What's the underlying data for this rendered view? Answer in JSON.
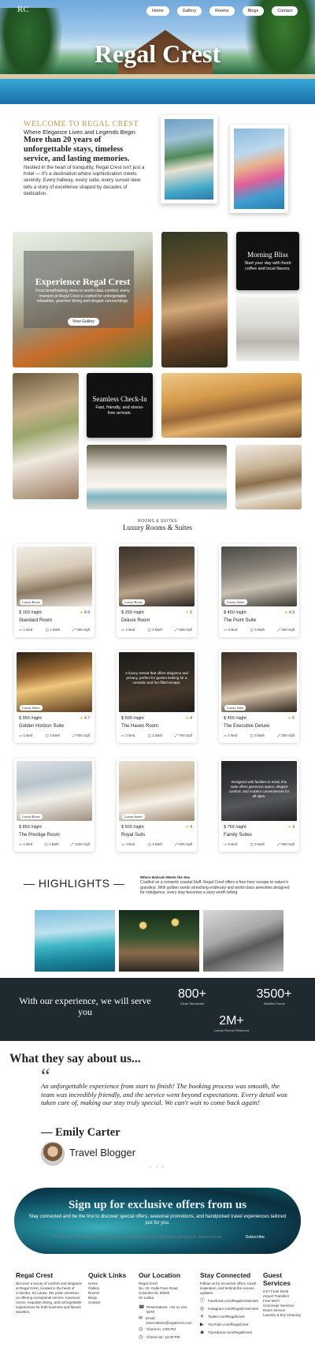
{
  "header": {
    "logo_mark": "RC",
    "title": "Regal Crest",
    "nav": [
      "Home",
      "Gallery",
      "Rooms",
      "Blogs",
      "Contact"
    ]
  },
  "welcome": {
    "kicker": "WELCOME TO REGAL CREST",
    "subtitle": "Where Elegance Lives and Legends Begin",
    "headline": "More than 20 years of unforgettable stays, timeless service, and lasting memories.",
    "body": "Nestled in the heart of tranquility, Regal Crest isn't just a hotel — it's a destination where sophistication meets serenity. Every hallway, every suite, every sunset view tells a story of excellence shaped by decades of dedication."
  },
  "gallery": {
    "experience": {
      "title": "Experience Regal Crest",
      "desc": "From breathtaking views to world-class comfort, every moment at Regal Crest is crafted for unforgettable relaxation, gourmet dining and elegant surroundings.",
      "button": "View Gallery"
    },
    "morning_bliss": {
      "title": "Morning Bliss",
      "desc": "Start your day with fresh coffee and local flavors."
    },
    "checkin": {
      "title": "Seamless Check-In",
      "desc": "Fast, friendly, and stress-free arrivals."
    }
  },
  "rooms": {
    "kicker": "ROOMS & SUITES",
    "title": "Luxury Rooms & Suites",
    "items": [
      {
        "tag": "Luxury Room",
        "price": "$ 150 /night",
        "rating": "4.9",
        "name": "Standard Room",
        "beds": "1 Bed",
        "baths": "1 Bath",
        "size": "300 Sqft",
        "overlay": ""
      },
      {
        "tag": "Luxury Room",
        "price": "$ 250 /night",
        "rating": "5",
        "name": "Deluxe Room",
        "beds": "2 Bed",
        "baths": "2 Bath",
        "size": "500 Sqft",
        "overlay": ""
      },
      {
        "tag": "Luxury Suites",
        "price": "$ 450 /night",
        "rating": "4.9",
        "name": "The Point Suite",
        "beds": "3 Bed",
        "baths": "3 Bath",
        "size": "250 Sqft",
        "overlay": ""
      },
      {
        "tag": "Luxury Suites",
        "price": "$ 950 /night",
        "rating": "4.7",
        "name": "Golden Horizon Suite",
        "beds": "1 Bed",
        "baths": "3 Bath",
        "size": "900 Sqft",
        "overlay": ""
      },
      {
        "tag": "",
        "price": "$ 500 /night",
        "rating": "4",
        "name": "The Haven Room",
        "beds": "2 Bed",
        "baths": "2 Bath",
        "size": "750 Sqft",
        "overlay": "A luxury retreat that offers elegance and privacy, perfect for guests looking for a romantic and fun-filled escape."
      },
      {
        "tag": "Luxury Suite",
        "price": "$ 450 /night",
        "rating": "5",
        "name": "The Executive Deluxe",
        "beds": "1 Bed",
        "baths": "3 Bath",
        "size": "350 Sqft",
        "overlay": ""
      },
      {
        "tag": "Luxury Room",
        "price": "$ 850 /night",
        "rating": "",
        "name": "The Prestige Room",
        "beds": "1 Bed",
        "baths": "4 Bath",
        "size": "1300 Sqft",
        "overlay": ""
      },
      {
        "tag": "Luxury Suites",
        "price": "$ 500 /night",
        "rating": "4",
        "name": "Royal Suits",
        "beds": "4 Bed",
        "baths": "3 Bath",
        "size": "825 Sqft",
        "overlay": ""
      },
      {
        "tag": "",
        "price": "$ 750 /night",
        "rating": "4",
        "name": "Family Suites",
        "beds": "5 Bed",
        "baths": "3 Bath",
        "size": "950 Sqft",
        "overlay": "Designed with families in mind, this suite offers generous space, elegant comfort, and modern conveniences for all ages."
      }
    ]
  },
  "highlights": {
    "title": "— HIGHLIGHTS —",
    "kicker": "Where Bahrain Meets the Sea",
    "desc": "Cradled on a romantic coastal bluff, Regal Crest offers a four-hour escape to nature's grandeur. With golden sands stretching endlessly and world-class amenities designed for indulgence, every stay becomes a story worth telling."
  },
  "stats": {
    "lead": "With our experience, we will serve you",
    "items": [
      {
        "n": "800+",
        "c": "Clean Worldwide"
      },
      {
        "n": "3500+",
        "c": "Satisfied Guest"
      },
      {
        "n": "2M+",
        "c": "Luxury Rooms Reserved"
      }
    ]
  },
  "testimonial": {
    "heading": "What they say about us...",
    "quote_mark": "“",
    "text": "An unforgettable experience from start to finish! The booking process was smooth, the team was incredibly friendly, and the service went beyond expectations. Every detail was taken care of, making our stay truly special. We can't wait to come back again!",
    "name": "— Emily Carter",
    "role": "Travel Blogger",
    "dots": "• • •"
  },
  "signup": {
    "title": "Sign up for exclusive offers from us",
    "desc": "Stay connected and be the first to discover special offers, seasonal promotions, and handpicked travel experiences tailored just for you.",
    "placeholder": "Enjoy member access to members-only deals and unforgettable getaways, delivered straight to your inbox!",
    "button": "Subscribe"
  },
  "footer": {
    "brand": {
      "title": "Regal Crest",
      "desc": "Discover a luxury of comfort and elegance at Regal Crest, located in the heart of Colombo, Sri Lanka. We pride ourselves on offering exceptional service, luxurious rooms, exquisite dining, and unforgettable experiences for both business and leisure travelers."
    },
    "quick": {
      "title": "Quick Links",
      "links": [
        "Home",
        "Gallery",
        "Rooms",
        "Blogs",
        "Contact"
      ]
    },
    "location": {
      "title": "Our Location",
      "address": "Regal Crest\nNo. 23, Galle Face Road\nColombo 03, 00300\nSri Lanka",
      "phone": "Reservations: +94 11 234 5678",
      "email": "Email: reservations@regalcrest.com",
      "checkin": "Check-in: 2:00 PM",
      "checkout": "Check-out: 12:00 PM"
    },
    "social": {
      "title": "Stay Connected",
      "desc": "Follow us for exclusive offers, travel inspiration, and behind-the-scenes updates:",
      "links": [
        "Facebook.com/RegalCrestHotel",
        "Instagram.com/RegalCrestHotel",
        "Twitter.com/RegalCrest",
        "YouTube.com/RegalCrest",
        "TripAdvisor.com/RegalCrest"
      ]
    },
    "services": {
      "title": "Guest Services",
      "items": [
        "24/7 Front Desk",
        "Airport Transfers",
        "Free Wi-Fi",
        "Concierge Services",
        "Room Service",
        "Laundry & Dry Cleaning"
      ]
    }
  }
}
